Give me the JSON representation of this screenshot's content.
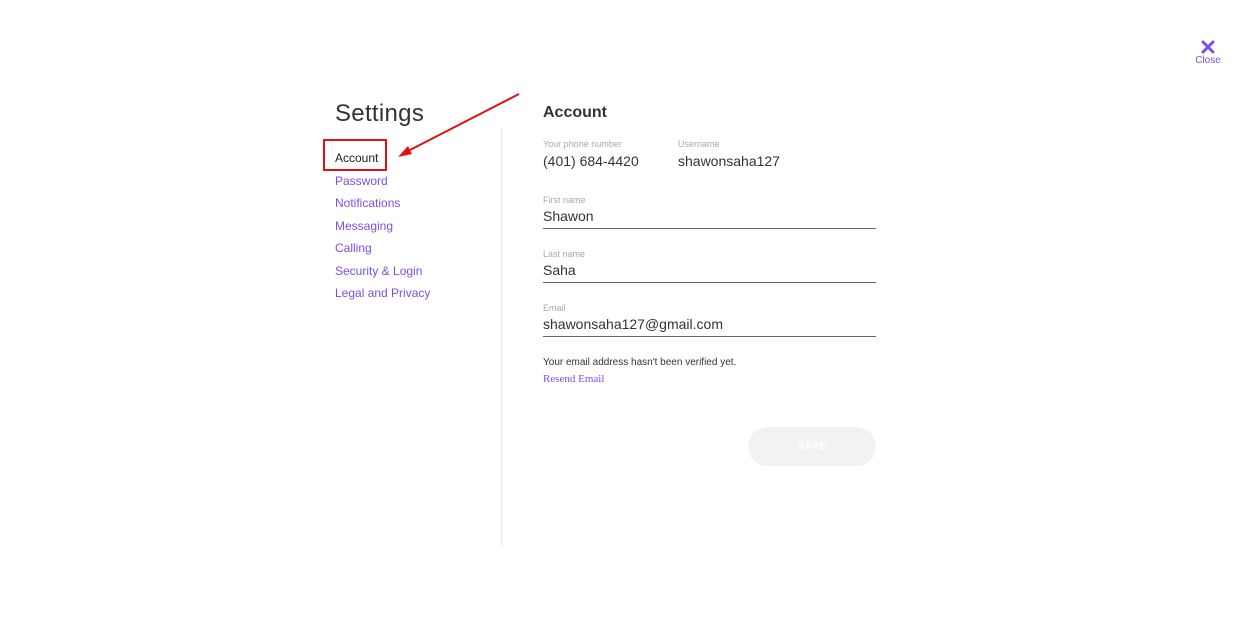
{
  "close": {
    "label": "Close",
    "icon": "close-icon"
  },
  "settings": {
    "title": "Settings",
    "nav": [
      {
        "label": "Account",
        "active": true
      },
      {
        "label": "Password"
      },
      {
        "label": "Notifications"
      },
      {
        "label": "Messaging"
      },
      {
        "label": "Calling"
      },
      {
        "label": "Security & Login"
      },
      {
        "label": "Legal and Privacy"
      }
    ]
  },
  "account": {
    "title": "Account",
    "phone": {
      "label": "Your phone number",
      "value": "(401) 684-4420"
    },
    "username": {
      "label": "Username",
      "value": "shawonsaha127"
    },
    "first_name": {
      "label": "First name",
      "value": "Shawon"
    },
    "last_name": {
      "label": "Last name",
      "value": "Saha"
    },
    "email": {
      "label": "Email",
      "value": "shawonsaha127@gmail.com"
    },
    "verify_note": "Your email address hasn't been verified yet.",
    "resend_label": "Resend Email",
    "save_label": "SAVE"
  },
  "colors": {
    "accent": "#7b4fe8",
    "annotation": "#e01212",
    "disabled_button": "#f2f2f2"
  }
}
